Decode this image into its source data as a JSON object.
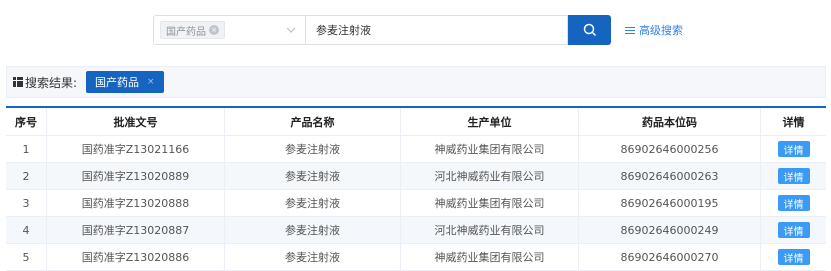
{
  "search": {
    "db_tag": "国产药品",
    "db_tag_close": "×",
    "keyword": "参麦注射液",
    "advanced_label": "高级搜索",
    "advanced_icon": "filter-lines-icon"
  },
  "results": {
    "label": "搜索结果:",
    "active_tag": "国产药品",
    "active_tag_close": "×"
  },
  "table": {
    "headers": [
      "序号",
      "批准文号",
      "产品名称",
      "生产单位",
      "药品本位码",
      "详情"
    ],
    "rows": [
      {
        "no": "1",
        "approval": "国药准字Z13021166",
        "product": "参麦注射液",
        "maker": "神威药业集团有限公司",
        "code": "86902646000256",
        "detail": "详情"
      },
      {
        "no": "2",
        "approval": "国药准字Z13020889",
        "product": "参麦注射液",
        "maker": "河北神威药业有限公司",
        "code": "86902646000263",
        "detail": "详情"
      },
      {
        "no": "3",
        "approval": "国药准字Z13020888",
        "product": "参麦注射液",
        "maker": "神威药业集团有限公司",
        "code": "86902646000195",
        "detail": "详情"
      },
      {
        "no": "4",
        "approval": "国药准字Z13020887",
        "product": "参麦注射液",
        "maker": "河北神威药业有限公司",
        "code": "86902646000249",
        "detail": "详情"
      },
      {
        "no": "5",
        "approval": "国药准字Z13020886",
        "product": "参麦注射液",
        "maker": "神威药业集团有限公司",
        "code": "86902646000270",
        "detail": "详情"
      }
    ]
  },
  "colors": {
    "primary": "#1565c0",
    "detail_button": "#3a9af5",
    "link": "#2f80ed"
  }
}
